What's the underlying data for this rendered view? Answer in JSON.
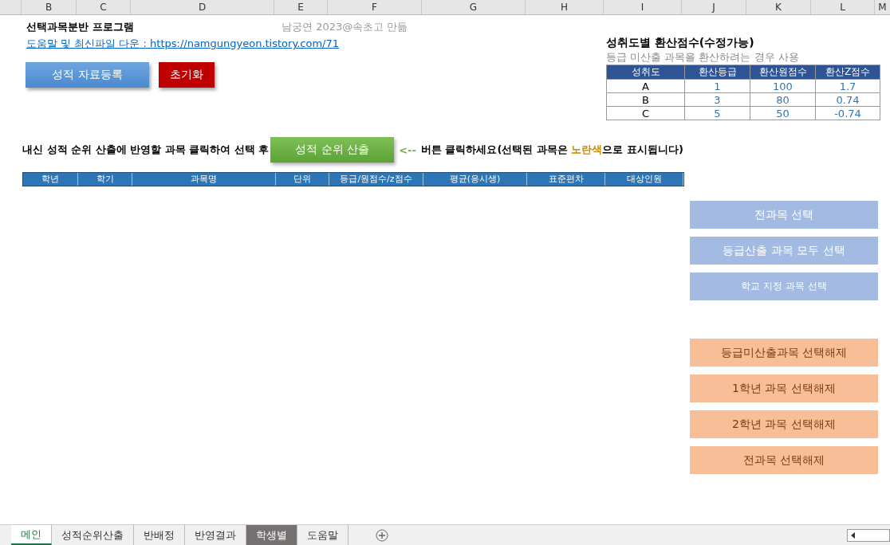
{
  "columns": [
    "B",
    "C",
    "D",
    "E",
    "F",
    "G",
    "H",
    "I",
    "J",
    "K",
    "L",
    "M"
  ],
  "title": "선택과목분반 프로그램",
  "author": "남궁연 2023@속초고 만듦",
  "help_link": "도움말 및 최신파일 다운 : https://namgungyeon.tistory.com/71",
  "top_buttons": [
    {
      "label": "성적 자료등록",
      "kind": "blue"
    },
    {
      "label": "초기화",
      "kind": "red"
    }
  ],
  "conversion": {
    "title": "성취도별 환산점수(수정가능)",
    "subtitle": "등급 미산출 과목을 환산하려는 경우 사용",
    "columns": [
      "성취도",
      "환산등급",
      "환산원점수",
      "환산Z점수"
    ],
    "rows": [
      [
        "A",
        "1",
        "100",
        "1.7"
      ],
      [
        "B",
        "3",
        "80",
        "0.74"
      ],
      [
        "C",
        "5",
        "50",
        "-0.74"
      ]
    ]
  },
  "instruction": {
    "before": "내신 성적 순위 산출에 반영할 과목 클릭하여 선택 후",
    "button": "성적 순위 산출",
    "arrow": "<--",
    "after": "버튼 클릭하세요(선택된 과목은 ",
    "highlight": "노란색",
    "end": "으로 표시됩니다)"
  },
  "table": {
    "columns": [
      "학년",
      "학기",
      "과목명",
      "단위",
      "등급/원점수/z점수",
      "평균(응시생)",
      "표준편차",
      "대상인원"
    ]
  },
  "side_buttons": [
    {
      "label": "전과목 선택",
      "kind": "select"
    },
    {
      "label": "등급산출 과목 모두 선택",
      "kind": "select"
    },
    {
      "label": "학교 지정 과목 선택",
      "kind": "select"
    },
    {
      "label": "등급미산출과목 선택해제",
      "kind": "deselect"
    },
    {
      "label": "1학년 과목 선택해제",
      "kind": "deselect"
    },
    {
      "label": "2학년 과목 선택해제",
      "kind": "deselect"
    },
    {
      "label": "전과목 선택해제",
      "kind": "deselect"
    }
  ],
  "sheet_tabs": [
    {
      "label": "메인",
      "selected": true
    },
    {
      "label": "성적순위산출",
      "selected": false
    },
    {
      "label": "반배정",
      "selected": false
    },
    {
      "label": "반영결과",
      "selected": false
    },
    {
      "label": "학생별",
      "selected": false,
      "color": "#767171"
    },
    {
      "label": "도움말",
      "selected": false
    }
  ]
}
